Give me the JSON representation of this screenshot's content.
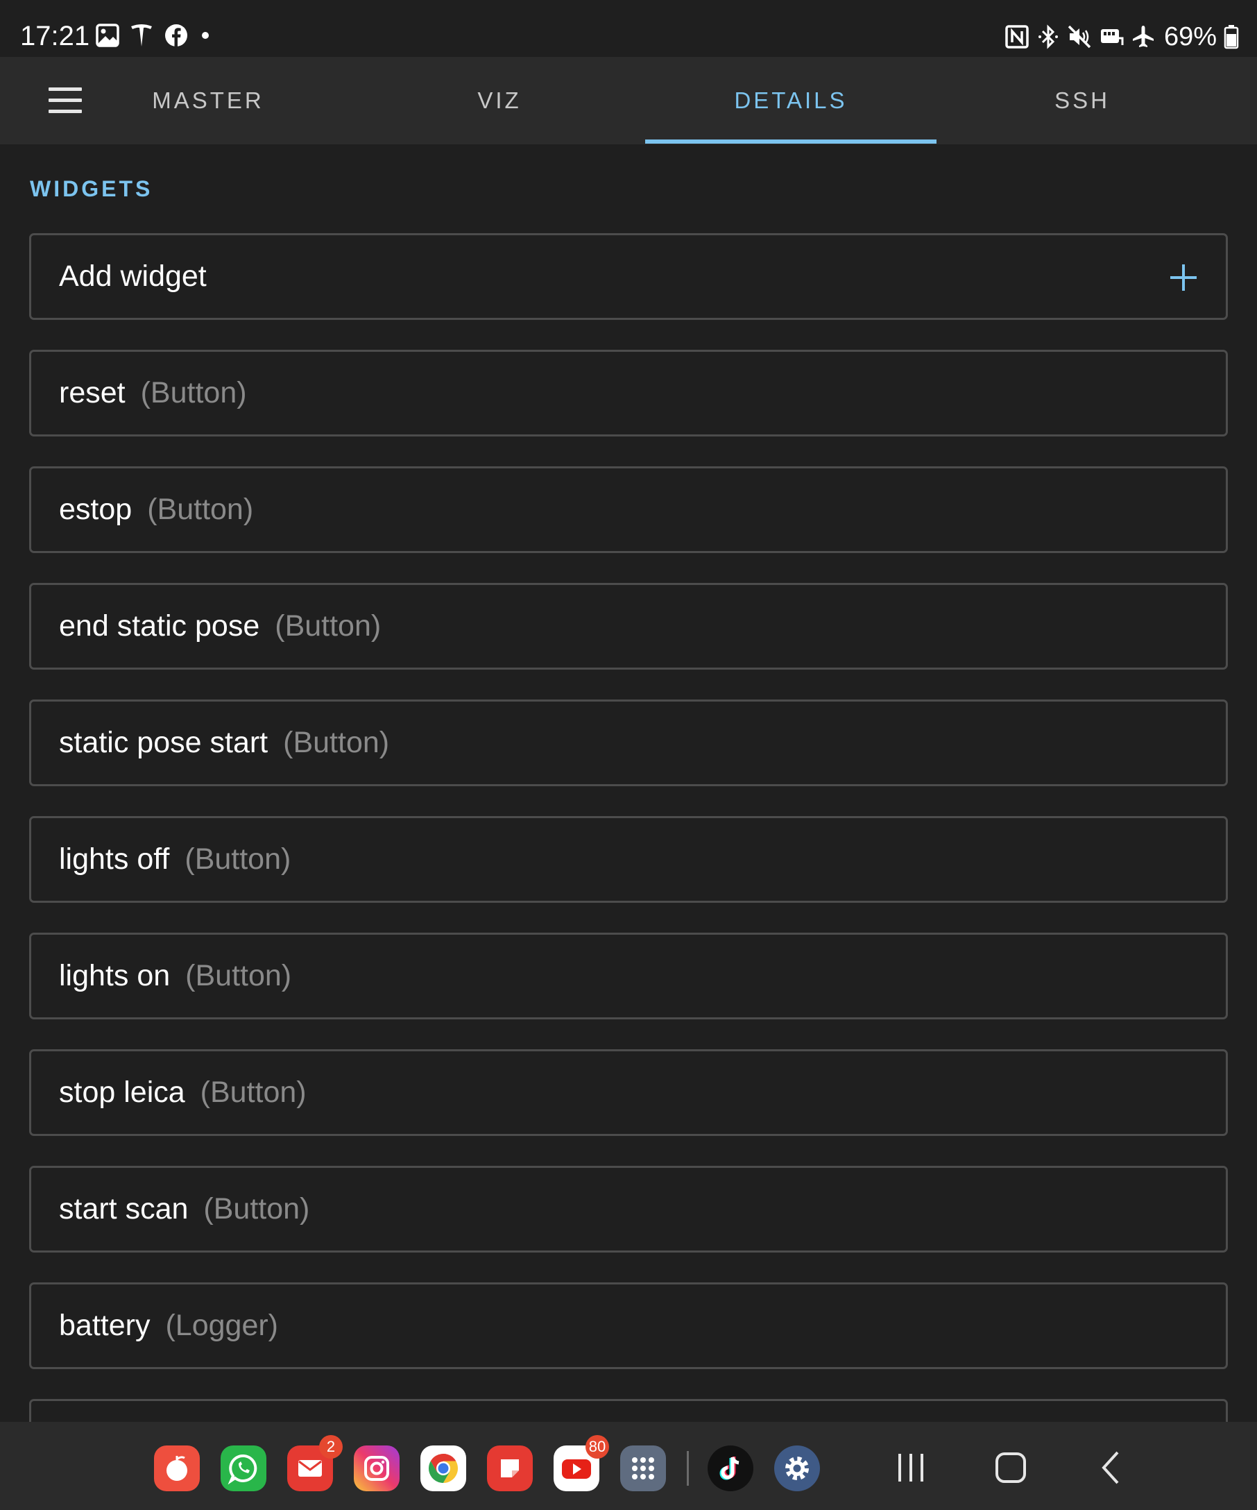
{
  "status_bar": {
    "time": "17:21",
    "battery": "69%",
    "left_icons": [
      "gallery-icon",
      "tesla-icon",
      "facebook-icon",
      "dot-icon"
    ],
    "right_icons": [
      "nfc-icon",
      "bluetooth-icon",
      "mute-icon",
      "wifi-calling-icon",
      "airplane-icon",
      "battery-icon"
    ]
  },
  "tabs": [
    {
      "label": "MASTER",
      "active": false
    },
    {
      "label": "VIZ",
      "active": false
    },
    {
      "label": "DETAILS",
      "active": true
    },
    {
      "label": "SSH",
      "active": false
    }
  ],
  "section": {
    "title": "WIDGETS"
  },
  "add_widget": {
    "label": "Add widget",
    "icon": "plus-icon"
  },
  "widgets": [
    {
      "name": "reset",
      "type": "(Button)"
    },
    {
      "name": "estop",
      "type": "(Button)"
    },
    {
      "name": "end static pose",
      "type": "(Button)"
    },
    {
      "name": "static pose start",
      "type": "(Button)"
    },
    {
      "name": "lights off",
      "type": "(Button)"
    },
    {
      "name": "lights on",
      "type": "(Button)"
    },
    {
      "name": "stop leica",
      "type": "(Button)"
    },
    {
      "name": "start scan",
      "type": "(Button)"
    },
    {
      "name": "battery",
      "type": "(Logger)"
    }
  ],
  "dock": {
    "apps": [
      {
        "name": "tomato-app-icon",
        "badge": ""
      },
      {
        "name": "whatsapp-icon",
        "badge": ""
      },
      {
        "name": "mail-icon",
        "badge": "2"
      },
      {
        "name": "instagram-icon",
        "badge": ""
      },
      {
        "name": "chrome-icon",
        "badge": ""
      },
      {
        "name": "notes-app-icon",
        "badge": ""
      },
      {
        "name": "youtube-icon",
        "badge": "80"
      },
      {
        "name": "app-drawer-icon",
        "badge": ""
      },
      {
        "name": "tiktok-icon",
        "badge": ""
      },
      {
        "name": "settings-icon",
        "badge": ""
      }
    ],
    "nav_buttons": [
      "recents-icon",
      "home-icon",
      "back-icon"
    ]
  },
  "colors": {
    "accent": "#7cc4ef",
    "background": "#1f1f1f",
    "tab_bar": "#2b2b2b",
    "border": "#4c4c4c",
    "muted_text": "#8a8a8a"
  }
}
